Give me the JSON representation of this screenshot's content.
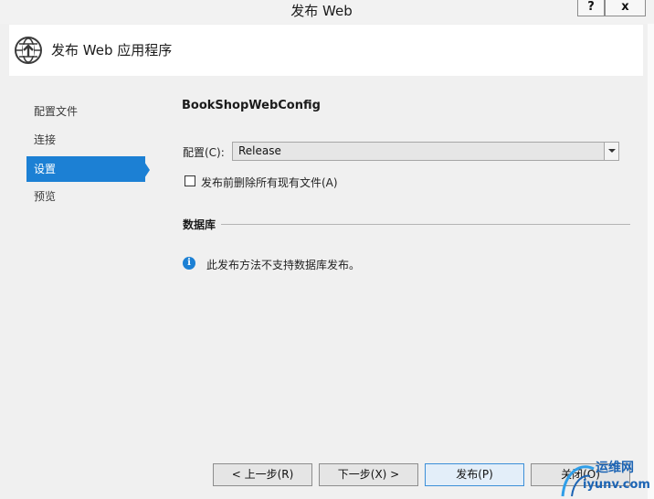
{
  "window": {
    "title": "发布 Web",
    "help_label": "?",
    "close_label": "x"
  },
  "header": {
    "title": "发布 Web 应用程序",
    "icon": "globe-publish-icon"
  },
  "sidebar": {
    "items": [
      {
        "label": "配置文件",
        "active": false
      },
      {
        "label": "连接",
        "active": false
      },
      {
        "label": "设置",
        "active": true
      },
      {
        "label": "预览",
        "active": false
      }
    ]
  },
  "main": {
    "profile_name": "BookShopWebConfig",
    "config_label": "配置(C):",
    "config_value": "Release",
    "delete_files_label": "发布前删除所有现有文件(A)",
    "delete_files_checked": false,
    "database_section": "数据库",
    "info_icon": "i",
    "info_text": "此发布方法不支持数据库发布。"
  },
  "buttons": {
    "prev": "< 上一步(R)",
    "next": "下一步(X) >",
    "publish": "发布(P)",
    "close": "关闭(O)"
  },
  "watermark": {
    "cn": "运维网",
    "en": "iyunv.com"
  },
  "colors": {
    "accent": "#1c80d4",
    "background": "#f0f0f0"
  }
}
